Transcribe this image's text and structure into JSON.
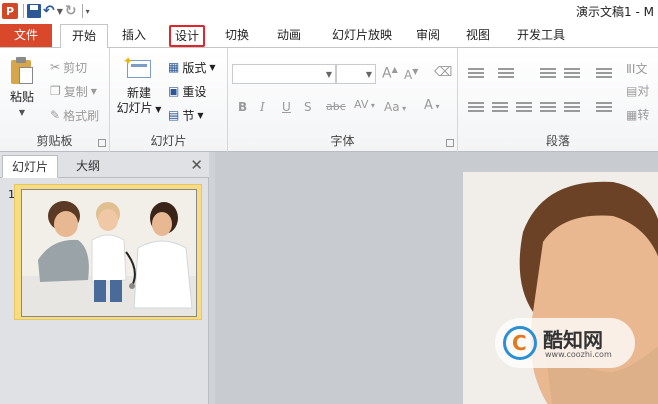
{
  "titlebar": {
    "app_icon_letter": "P",
    "doc_title": "演示文稿1 - M"
  },
  "tabs": [
    {
      "label": "文件"
    },
    {
      "label": "开始"
    },
    {
      "label": "插入"
    },
    {
      "label": "设计"
    },
    {
      "label": "切换"
    },
    {
      "label": "动画"
    },
    {
      "label": "幻灯片放映"
    },
    {
      "label": "审阅"
    },
    {
      "label": "视图"
    },
    {
      "label": "开发工具"
    }
  ],
  "ribbon": {
    "clipboard": {
      "paste": "粘贴",
      "cut": "剪切",
      "copy": "复制",
      "format_painter": "格式刷",
      "label": "剪贴板"
    },
    "slides": {
      "new_slide_line1": "新建",
      "new_slide_line2": "幻灯片",
      "layout": "版式",
      "reset": "重设",
      "section": "节",
      "label": "幻灯片"
    },
    "font": {
      "label": "字体",
      "grow": "A",
      "shrink": "A",
      "bold": "B",
      "italic": "I",
      "underline": "U",
      "shadow": "S",
      "strike": "abc",
      "spacing": "AV",
      "case": "Aa",
      "color": "A"
    },
    "paragraph": {
      "label": "段落",
      "text_dir": "文",
      "align_text": "对",
      "convert": "转"
    }
  },
  "left_pane": {
    "tab_slides": "幻灯片",
    "tab_outline": "大纲",
    "close": "✕",
    "slide_number": "1"
  },
  "watermark": {
    "name": "酷知网",
    "url": "www.coozhi.com"
  }
}
